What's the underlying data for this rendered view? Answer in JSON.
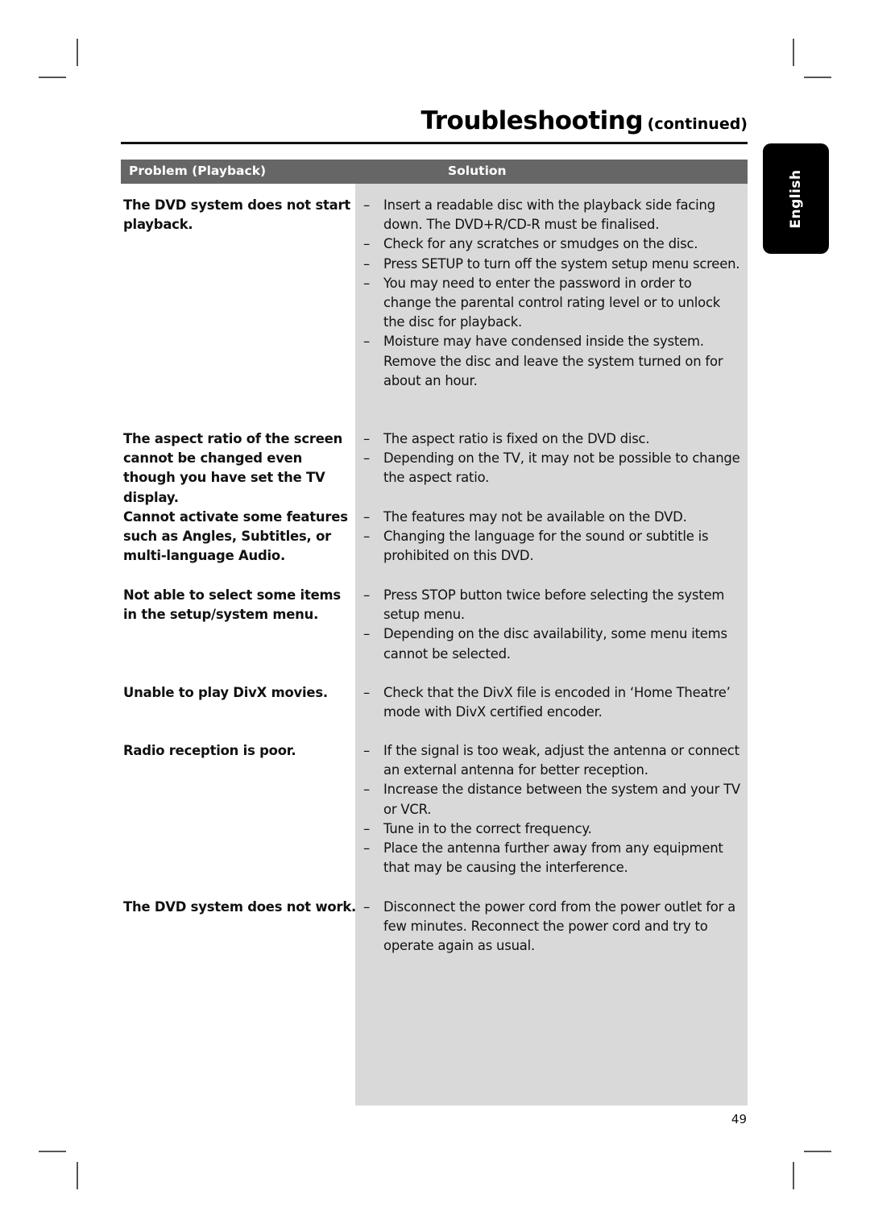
{
  "header": {
    "title": "Troubleshooting",
    "subtitle": "(continued)"
  },
  "language_tab": "English",
  "table": {
    "columns": [
      "Problem (Playback)",
      "Solution"
    ],
    "rows": [
      {
        "problem": "The DVD system does not start playback.",
        "solutions": [
          "Insert a readable disc with the playback side facing down. The DVD+R/CD-R must be finalised.",
          "Check for any scratches or smudges on the disc.",
          "Press SETUP to turn off the system setup menu screen.",
          "You may need to enter the password in order to change the parental control rating level or to unlock the disc for playback.",
          "Moisture may have condensed inside the system. Remove the disc and leave the system turned on for about an hour."
        ]
      },
      {
        "problem": "The aspect ratio of the screen cannot be changed even though you have set the TV display.",
        "solutions": [
          "The aspect ratio is fixed on the DVD disc.",
          "Depending on the TV, it may not be possible to change the aspect ratio."
        ]
      },
      {
        "problem": "Cannot activate some features such as Angles, Subtitles, or multi-language Audio.",
        "solutions": [
          "The features may not be available on the DVD.",
          "Changing the language for the sound or subtitle is prohibited on this DVD."
        ]
      },
      {
        "problem": "Not able to select some items in the setup/system menu.",
        "solutions": [
          "Press STOP button twice before selecting the system setup menu.",
          "Depending on the disc availability, some menu items cannot be selected."
        ]
      },
      {
        "problem": "Unable to play DivX movies.",
        "solutions": [
          "Check that the DivX file is encoded in ‘Home Theatre’ mode with DivX certified encoder."
        ]
      },
      {
        "problem": "Radio reception is poor.",
        "solutions": [
          "If the signal is too weak, adjust the antenna or connect an external antenna for better reception.",
          "Increase the distance between the system and your TV or VCR.",
          "Tune in to the correct frequency.",
          "Place the antenna further away from any equipment that may be causing the interference."
        ]
      },
      {
        "problem": "The DVD system does not work.",
        "solutions": [
          "Disconnect the power cord from the power outlet for a few minutes. Reconnect the power cord and try to operate again as usual."
        ]
      }
    ]
  },
  "footer": {
    "page_number": "49"
  },
  "dash_glyph": "–"
}
